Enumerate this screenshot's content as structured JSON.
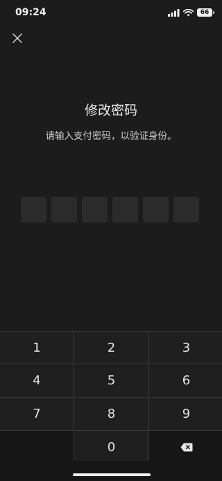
{
  "status_bar": {
    "time": "09:24",
    "battery": "66",
    "icons": [
      "signal-icon",
      "wifi-icon",
      "battery-icon"
    ]
  },
  "header": {
    "close_icon": "close-icon"
  },
  "main": {
    "title": "修改密码",
    "subtitle": "请输入支付密码，以验证身份。",
    "pin_length": 6,
    "pin_filled": 0
  },
  "keypad": {
    "keys": [
      "1",
      "2",
      "3",
      "4",
      "5",
      "6",
      "7",
      "8",
      "9",
      "0"
    ],
    "delete_icon": "backspace-icon"
  },
  "colors": {
    "background": "#1c1c1c",
    "pin_box": "#2b2b2b",
    "key_bg": "#1f1f1f",
    "divider": "#3a3a3a"
  }
}
